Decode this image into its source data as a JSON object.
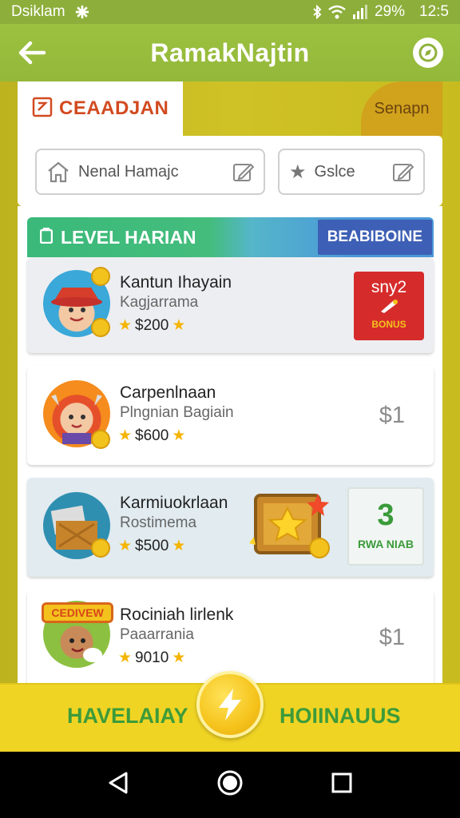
{
  "status_bar": {
    "carrier": "Dsiklam",
    "battery": "29%",
    "time": "12:5"
  },
  "app_bar": {
    "title": "RamakNajtin",
    "back_icon": "arrow-left-icon",
    "action_icon": "compass-icon"
  },
  "tabs": {
    "active_label": "CEAADJAN",
    "right_label": "Senapn"
  },
  "filters": {
    "name_field": "Nenal Hamajc",
    "category_field": "Gslce"
  },
  "level": {
    "title": "LEVEL HARIAN",
    "badge": "BEABIBOINE"
  },
  "items": [
    {
      "name": "Kantun Ihayain",
      "sub": "Kagjarrama",
      "price": "$200",
      "promo_top": "sny2",
      "promo_bottom": "BONUS"
    },
    {
      "name": "Carpenlnaan",
      "sub": "Plngnian Bagiain",
      "price": "$600",
      "right_price": "$1"
    },
    {
      "name": "Karmiuokrlaan",
      "sub": "Rostimema",
      "price": "$500",
      "promo_number": "3",
      "promo_label": "RWA NIAB"
    },
    {
      "name": "Rociniah lirlenk",
      "sub": "Paaarrania",
      "price": "9010",
      "right_price": "$1",
      "avatar_banner": "CEDIVEW"
    }
  ],
  "bottom_bar": {
    "left_label": "HAVELAIAY",
    "right_label": "HOIINAUUS"
  },
  "colors": {
    "accent_green": "#94b83a",
    "accent_yellow": "#f0d424",
    "brand_red": "#d24a20"
  }
}
